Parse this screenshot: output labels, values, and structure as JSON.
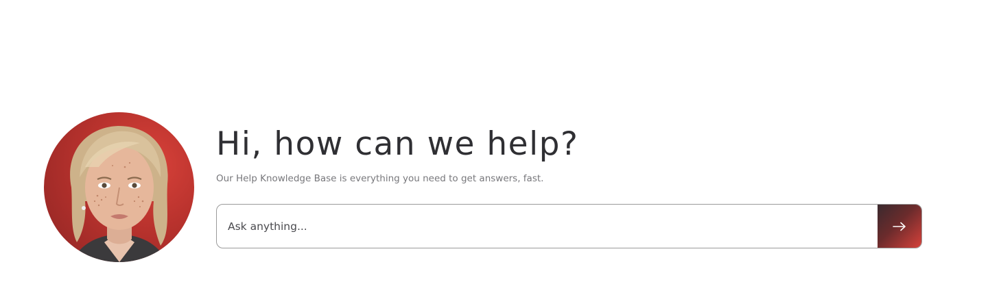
{
  "hero": {
    "title": "Hi, how can we help?",
    "subtitle": "Our Help Knowledge Base is everything you need to get answers, fast."
  },
  "avatar": {
    "description_icon": "support-agent-portrait",
    "background_color": "#c4362f"
  },
  "search": {
    "placeholder": "Ask anything...",
    "value": "",
    "submit_icon": "arrow-right-icon",
    "button_gradient": [
      "#3a2a2e",
      "#d6413a"
    ]
  },
  "colors": {
    "title": "#2f2f33",
    "subtitle": "#77777b",
    "border": "#9a9a9a"
  }
}
